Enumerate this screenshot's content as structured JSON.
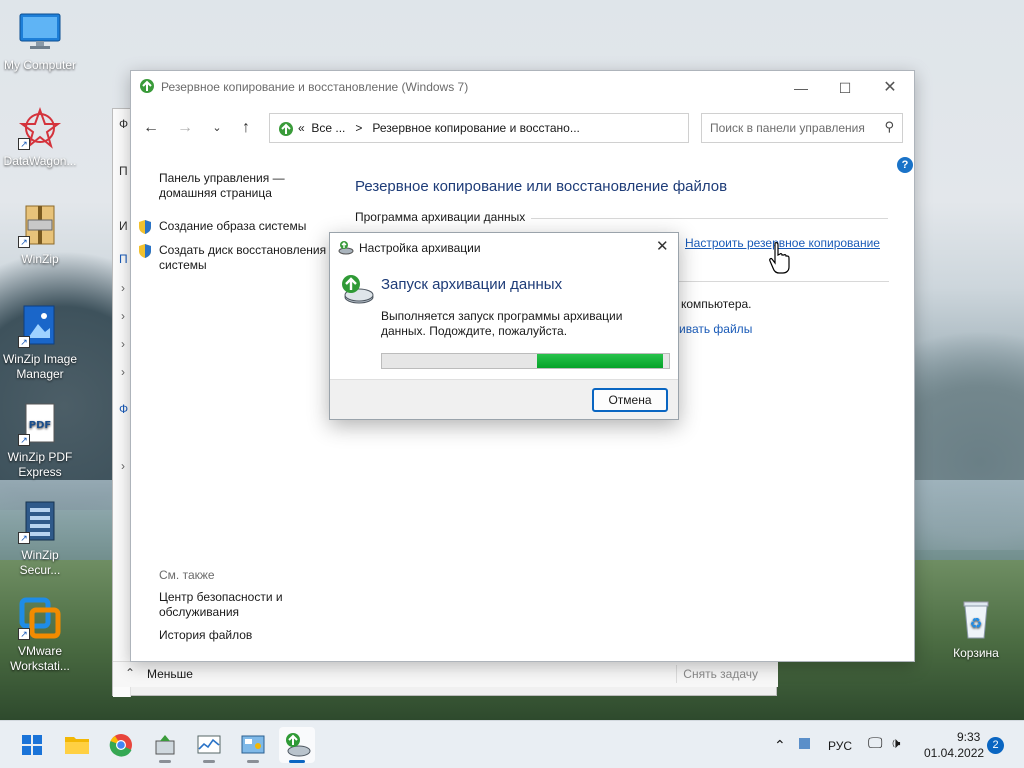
{
  "desktop": {
    "icons": [
      {
        "label": "My Computer",
        "icon": "monitor-icon"
      },
      {
        "label": "DataWagon...",
        "icon": "datawagon-icon"
      },
      {
        "label": "WinZip",
        "icon": "winzip-icon"
      },
      {
        "label": "WinZip Image Manager",
        "icon": "winzip-image-icon"
      },
      {
        "label": "WinZip PDF Express",
        "icon": "pdf-icon"
      },
      {
        "label": "WinZip Secur...",
        "icon": "winzip-secure-icon"
      },
      {
        "label": "VMware Workstati...",
        "icon": "vmware-icon"
      },
      {
        "label": "Корзина",
        "icon": "recycle-bin-icon"
      }
    ]
  },
  "task_manager": {
    "letters": [
      "Ф",
      "П",
      "И",
      "П",
      "Ф"
    ],
    "less_label": "Меньше",
    "end_task_label": "Снять задачу"
  },
  "window": {
    "title": "Резервное копирование и восстановление (Windows 7)",
    "address": {
      "prefix": "«",
      "crumb1": "Все ...",
      "separator": ">",
      "crumb2": "Резервное копирование и восстано..."
    },
    "search_placeholder": "Поиск в панели управления",
    "sidebar": {
      "home_line1": "Панель управления —",
      "home_line2": "домашняя страница",
      "create_image": "Создание образа системы",
      "create_disk_line1": "Создать диск восстановления",
      "create_disk_line2": "системы",
      "see_also": "См. также",
      "security_line1": "Центр безопасности и",
      "security_line2": "обслуживания",
      "file_history": "История файлов"
    },
    "main": {
      "heading": "Резервное копирование или восстановление файлов",
      "section": "Программа архивации данных",
      "setup_link": "Настроить резервное копирование",
      "computer_text": "компьютера.",
      "restore_text": "ивать файлы"
    }
  },
  "dialog": {
    "title": "Настройка архивации",
    "heading": "Запуск архивации данных",
    "message": "Выполняется запуск программы архивации данных. Подождите, пожалуйста.",
    "progress_start": 0.54,
    "progress_end": 0.98,
    "cancel_label": "Отмена"
  },
  "taskbar": {
    "apps": [
      "start-icon",
      "file-explorer-icon",
      "chrome-icon",
      "green-app-icon",
      "task-manager-icon",
      "control-panel-icon",
      "backup-icon"
    ],
    "language": "РУС",
    "time": "9:33",
    "date": "01.04.2022",
    "notifications": "2"
  }
}
